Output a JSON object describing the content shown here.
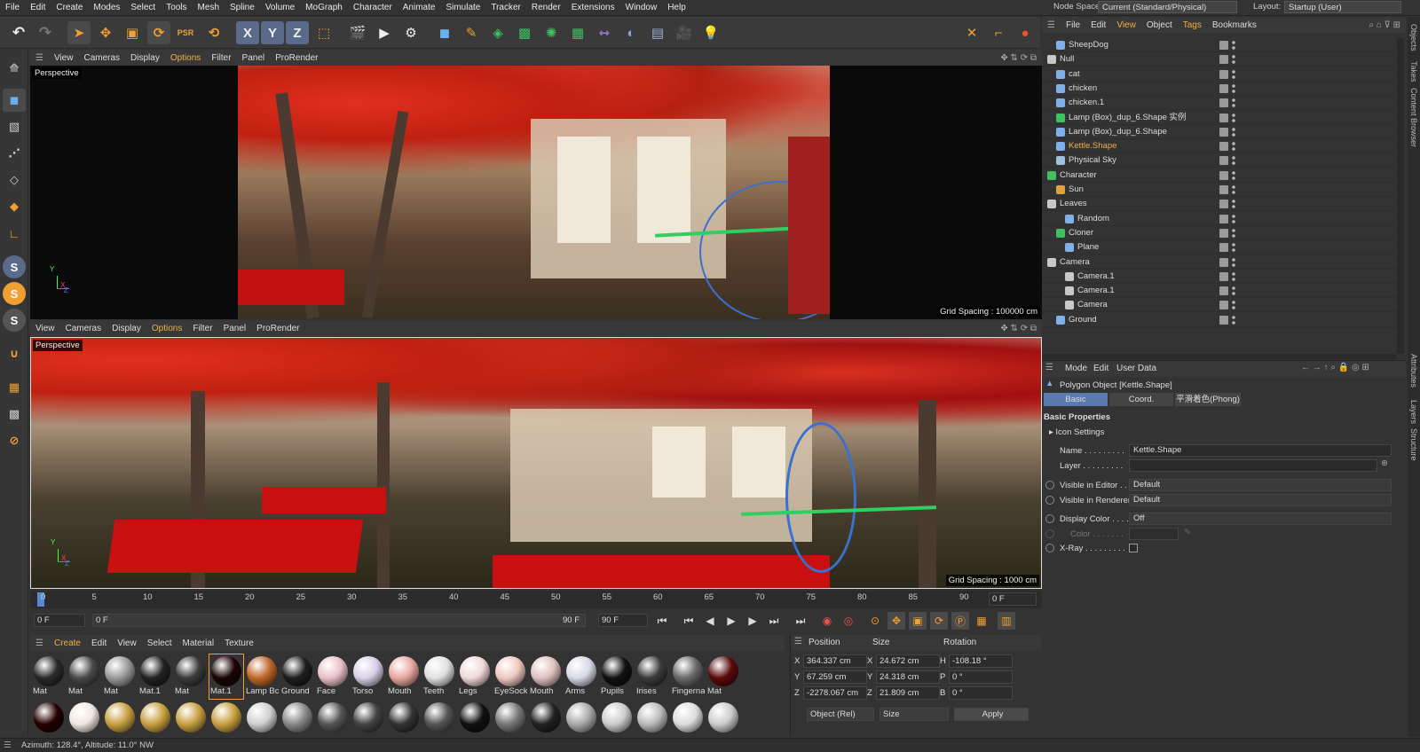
{
  "menu": [
    "File",
    "Edit",
    "Create",
    "Modes",
    "Select",
    "Tools",
    "Mesh",
    "Spline",
    "Volume",
    "MoGraph",
    "Character",
    "Animate",
    "Simulate",
    "Tracker",
    "Render",
    "Extensions",
    "Window",
    "Help"
  ],
  "node_space": {
    "label": "Node Space:",
    "value": "Current (Standard/Physical)"
  },
  "layout": {
    "label": "Layout:",
    "value": "Startup (User)"
  },
  "toolbar_axes": [
    "X",
    "Y",
    "Z"
  ],
  "viewport_menu": [
    "View",
    "Cameras",
    "Display",
    "Options",
    "Filter",
    "Panel",
    "ProRender"
  ],
  "viewport_top": {
    "label": "Perspective",
    "grid": "Grid Spacing : 100000 cm"
  },
  "viewport_bottom": {
    "label": "Perspective",
    "grid": "Grid Spacing : 1000 cm"
  },
  "axis_labels": {
    "x": "X",
    "y": "Y",
    "z": "Z"
  },
  "timeline": {
    "ticks": [
      "0",
      "5",
      "10",
      "15",
      "20",
      "25",
      "30",
      "35",
      "40",
      "45",
      "50",
      "55",
      "60",
      "65",
      "70",
      "75",
      "80",
      "85",
      "90"
    ],
    "current_frame": "0 F",
    "start": "0 F",
    "range_start": "0 F",
    "range_end": "90 F",
    "end": "90 F"
  },
  "material_menu": [
    "Create",
    "Edit",
    "View",
    "Select",
    "Material",
    "Texture"
  ],
  "materials_row1": [
    {
      "label": "Mat",
      "color": "#2a2a2a"
    },
    {
      "label": "Mat",
      "color": "#4a4a4a"
    },
    {
      "label": "Mat",
      "color": "#9a9a9a"
    },
    {
      "label": "Mat.1",
      "color": "#222222"
    },
    {
      "label": "Mat",
      "color": "#3a3a3a"
    },
    {
      "label": "Mat.1",
      "color": "#1a0505"
    },
    {
      "label": "Lamp Bc",
      "color": "#c0682a"
    },
    {
      "label": "Ground",
      "color": "#1e1e1e"
    },
    {
      "label": "Face",
      "color": "#e8c0c8"
    },
    {
      "label": "Torso",
      "color": "#d8d0e8"
    },
    {
      "label": "Mouth",
      "color": "#e8a8a0"
    },
    {
      "label": "Teeth",
      "color": "#e0e0e0"
    },
    {
      "label": "Legs",
      "color": "#f0d8d8"
    },
    {
      "label": "EyeSock",
      "color": "#f0c8c0"
    },
    {
      "label": "Mouth",
      "color": "#e0c0c0"
    },
    {
      "label": "Arms",
      "color": "#d8d8e8"
    },
    {
      "label": "Pupils",
      "color": "#111111"
    },
    {
      "label": "Irises",
      "color": "#3a3a3a"
    },
    {
      "label": "Fingerna",
      "color": "#6a6a6a"
    },
    {
      "label": "Mat",
      "color": "#5a0a0a"
    }
  ],
  "materials_row2": [
    "#220000",
    "#f0e8e0",
    "#c8a040",
    "#c8a040",
    "#c8a040",
    "#c8a040",
    "#d0d0d0",
    "#888888",
    "#555555",
    "#444444",
    "#333333",
    "#555555",
    "#111111",
    "#777777",
    "#222222",
    "#aaaaaa",
    "#cccccc",
    "#bbbbbb",
    "#dddddd",
    "#cccccc"
  ],
  "coords": {
    "headers": [
      "Position",
      "Size",
      "Rotation"
    ],
    "pos": [
      {
        "axis": "X",
        "value": "364.337 cm"
      },
      {
        "axis": "Y",
        "value": "67.259 cm"
      },
      {
        "axis": "Z",
        "value": "-2278.067 cm"
      }
    ],
    "size": [
      {
        "axis": "X",
        "value": "24.672 cm"
      },
      {
        "axis": "Y",
        "value": "24.318 cm"
      },
      {
        "axis": "Z",
        "value": "21.809 cm"
      }
    ],
    "rot": [
      {
        "axis": "H",
        "value": "-108.18 °"
      },
      {
        "axis": "P",
        "value": "0 °"
      },
      {
        "axis": "B",
        "value": "0 °"
      }
    ],
    "mode": "Object (Rel)",
    "size_mode": "Size",
    "apply": "Apply"
  },
  "status": "Azimuth: 128.4°, Altitude: 11.0°  NW",
  "object_menu": [
    "File",
    "Edit",
    "View",
    "Object",
    "Tags",
    "Bookmarks"
  ],
  "objects": [
    {
      "name": "SheepDog",
      "indent": 1,
      "color": "#7fb0e8",
      "hl": false
    },
    {
      "name": "Null",
      "indent": 0,
      "color": "#c8c8c8",
      "hl": false
    },
    {
      "name": "cat",
      "indent": 1,
      "color": "#7fb0e8",
      "hl": false
    },
    {
      "name": "chicken",
      "indent": 1,
      "color": "#7fb0e8",
      "hl": false
    },
    {
      "name": "chicken.1",
      "indent": 1,
      "color": "#7fb0e8",
      "hl": false
    },
    {
      "name": "Lamp (Box)_dup_6.Shape 实例",
      "indent": 1,
      "color": "#40c060",
      "hl": false
    },
    {
      "name": "Lamp (Box)_dup_6.Shape",
      "indent": 1,
      "color": "#7fb0e8",
      "hl": false
    },
    {
      "name": "Kettle.Shape",
      "indent": 1,
      "color": "#7fb0e8",
      "hl": true
    },
    {
      "name": "Physical Sky",
      "indent": 1,
      "color": "#a0c0e0",
      "hl": false
    },
    {
      "name": "Character",
      "indent": 0,
      "color": "#40c060",
      "hl": false
    },
    {
      "name": "Sun",
      "indent": 1,
      "color": "#e0a040",
      "hl": false
    },
    {
      "name": "Leaves",
      "indent": 0,
      "color": "#c8c8c8",
      "hl": false
    },
    {
      "name": "Random",
      "indent": 2,
      "color": "#7fb0e8",
      "hl": false
    },
    {
      "name": "Cloner",
      "indent": 1,
      "color": "#40c060",
      "hl": false
    },
    {
      "name": "Plane",
      "indent": 2,
      "color": "#7fb0e8",
      "hl": false
    },
    {
      "name": "Camera",
      "indent": 0,
      "color": "#c8c8c8",
      "hl": false
    },
    {
      "name": "Camera.1",
      "indent": 2,
      "color": "#c8c8c8",
      "hl": false
    },
    {
      "name": "Camera.1",
      "indent": 2,
      "color": "#c8c8c8",
      "hl": false
    },
    {
      "name": "Camera",
      "indent": 2,
      "color": "#c8c8c8",
      "hl": false
    },
    {
      "name": "Ground",
      "indent": 1,
      "color": "#7fb0e8",
      "hl": false
    }
  ],
  "attr": {
    "menu": [
      "Mode",
      "Edit",
      "User Data"
    ],
    "title": "Polygon Object [Kettle.Shape]",
    "tabs": [
      "Basic",
      "Coord.",
      "平滑着色(Phong)"
    ],
    "section": "Basic Properties",
    "icon_settings": "Icon Settings",
    "name_label": "Name . . . . . . . . .",
    "name_value": "Kettle.Shape",
    "layer_label": "Layer . . . . . . . . .",
    "vis_editor_label": "Visible in Editor . .",
    "vis_editor_value": "Default",
    "vis_render_label": "Visible in Renderer",
    "vis_render_value": "Default",
    "display_color_label": "Display Color . . . .",
    "display_color_value": "Off",
    "color_label": "Color . . . . . . .",
    "xray_label": "X-Ray . . . . . . . . ."
  },
  "side_tabs": [
    "Objects",
    "Takes",
    "Content Browser",
    "Attributes",
    "Layers",
    "Structure"
  ]
}
